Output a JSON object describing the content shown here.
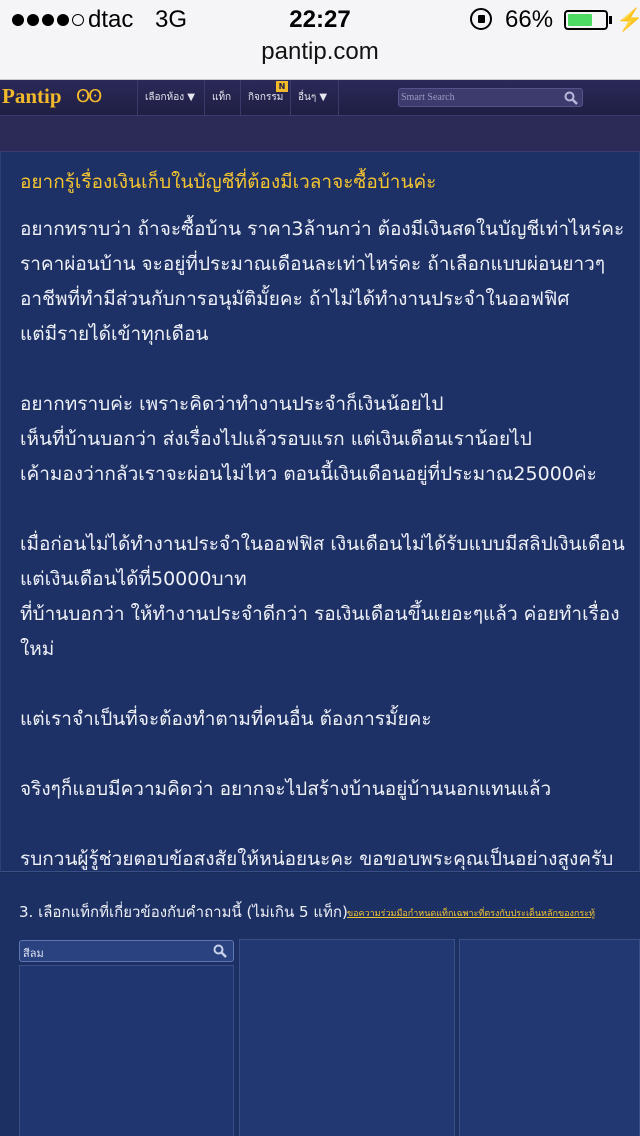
{
  "status_bar": {
    "carrier": "dtac",
    "network": "3G",
    "time": "22:27",
    "battery_percent": "66%",
    "battery_level": 0.66,
    "icons": [
      "signal-dots-icon",
      "rotation-lock-icon",
      "battery-icon",
      "charging-bolt-icon"
    ]
  },
  "browser": {
    "url": "pantip.com"
  },
  "header": {
    "logo_text": "Pantip",
    "logo_mark": "ʘʘ",
    "nav": [
      {
        "label": "เลือกห้อง ▼"
      },
      {
        "label": "แท็ก"
      },
      {
        "label": "กิจกรรม"
      },
      {
        "label": "อื่นๆ ▼"
      }
    ],
    "activity_badge": "N",
    "search_placeholder": "Smart Search"
  },
  "post": {
    "title": "อยากรู้เรื่องเงินเก็บในบัญชีที่ต้องมีเวลาจะซื้อบ้านค่ะ",
    "paragraphs": [
      "อยากทราบว่า ถ้าจะซื้อบ้าน ราคา3ล้านกว่า ต้องมีเงินสดในบัญชีเท่าไหร่คะ\nราคาผ่อนบ้าน จะอยู่ที่ประมาณเดือนละเท่าไหร่คะ ถ้าเลือกแบบผ่อนยาวๆ\nอาชีพที่ทำมีส่วนกับการอนุมัติมั้ยคะ ถ้าไม่ได้ทำงานประจำในออฟฟิศ\nแต่มีรายได้เข้าทุกเดือน",
      "อยากทราบค่ะ เพราะคิดว่าทำงานประจำก็เงินน้อยไป\nเห็นที่บ้านบอกว่า ส่งเรื่องไปแล้วรอบแรก แต่เงินเดือนเราน้อยไป\nเค้ามองว่ากลัวเราจะผ่อนไม่ไหว ตอนนี้เงินเดือนอยู่ที่ประมาณ25000ค่ะ",
      "เมื่อก่อนไม่ได้ทำงานประจำในออฟฟิส เงินเดือนไม่ได้รับแบบมีสลิปเงินเดือน\nแต่เงินเดือนได้ที่50000บาท\nที่บ้านบอกว่า ให้ทำงานประจำดีกว่า รอเงินเดือนขึ้นเยอะๆแล้ว ค่อยทำเรื่องใหม่",
      "แต่เราจำเป็นที่จะต้องทำตามที่คนอื่น ต้องการมั้ยคะ",
      "จริงๆก็แอบมีความคิดว่า อยากจะไปสร้างบ้านอยู่บ้านนอกแทนแล้ว",
      "รบกวนผู้รู้ช่วยตอบข้อสงสัยให้หน่อยนะคะ ขอขอบพระคุณเป็นอย่างสูงครับ"
    ]
  },
  "tags": {
    "heading": "3. เลือกแท็กที่เกี่ยวข้องกับคำถามนี้ (ไม่เกิน 5 แท็ก)",
    "note_link": "ขอความร่วมมือกำหนดแท็กเฉพาะที่ตรงกับประเด็นหลักของกระทู้",
    "search_value": "สีลม"
  }
}
